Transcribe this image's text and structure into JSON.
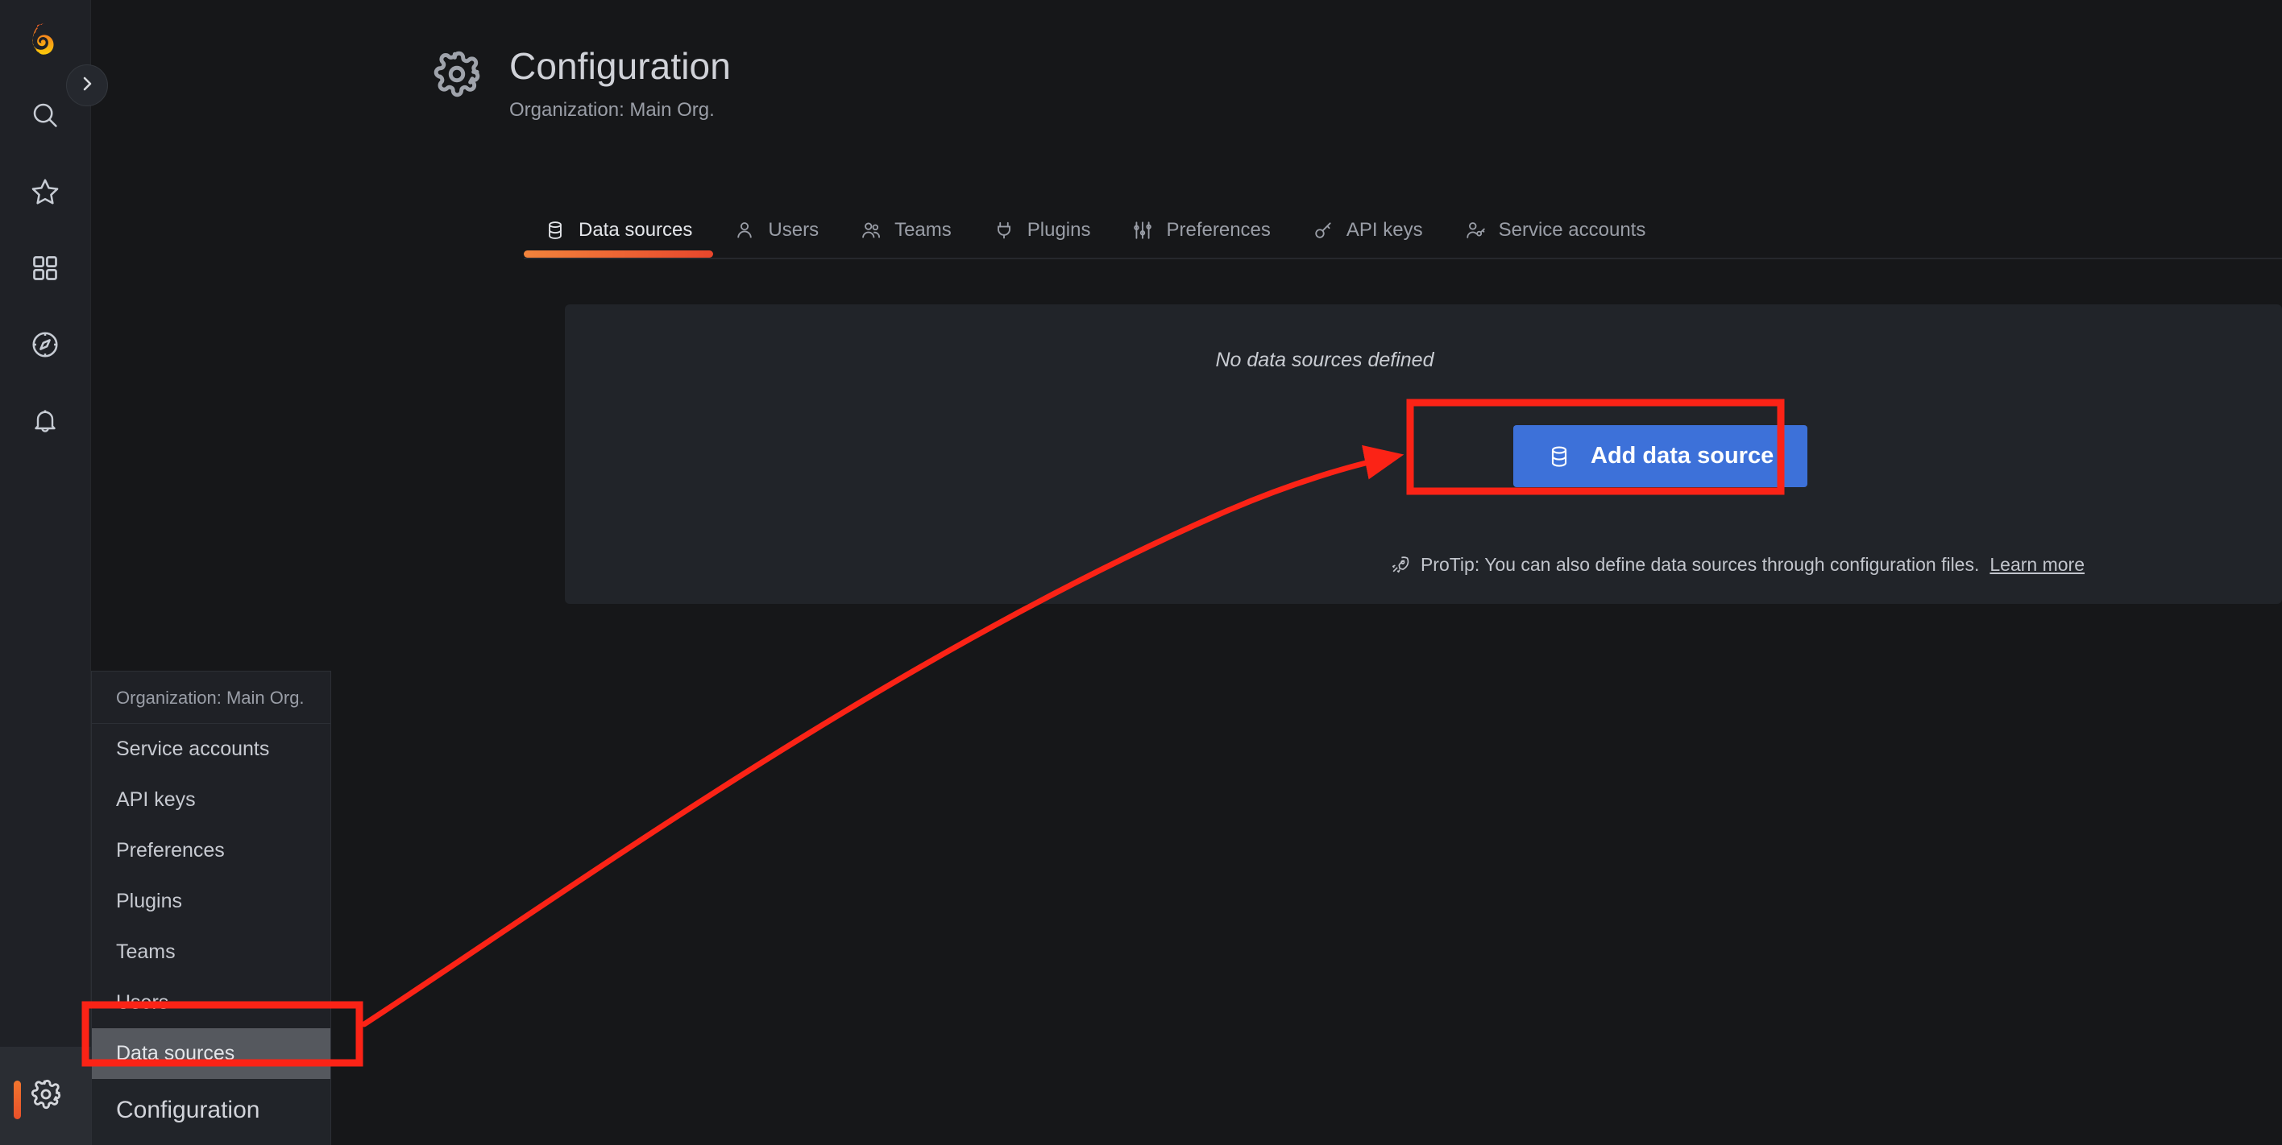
{
  "app": {
    "brand": "grafana-logo",
    "accent_orange": "#f2762e",
    "page_bg": "#161719",
    "panel_bg": "#212429",
    "primary_button_bg": "#3d71d9",
    "highlight_red": "#fb2316"
  },
  "sidebar": {
    "logo_name": "Grafana",
    "collapse_toggle": "chevron-right-icon",
    "items": [
      {
        "name": "search",
        "icon": "search-icon"
      },
      {
        "name": "starred",
        "icon": "star-icon"
      },
      {
        "name": "dashboards",
        "icon": "apps-grid-icon"
      },
      {
        "name": "explore",
        "icon": "compass-icon"
      },
      {
        "name": "alerting",
        "icon": "bell-icon"
      }
    ],
    "bottom_item": {
      "name": "configuration",
      "icon": "gear-icon",
      "active": true
    }
  },
  "header": {
    "icon": "gear-icon",
    "title": "Configuration",
    "subtitle": "Organization: Main Org."
  },
  "tabs": [
    {
      "label": "Data sources",
      "icon": "database-icon",
      "active": true
    },
    {
      "label": "Users",
      "icon": "user-icon",
      "active": false
    },
    {
      "label": "Teams",
      "icon": "users-icon",
      "active": false
    },
    {
      "label": "Plugins",
      "icon": "plug-icon",
      "active": false
    },
    {
      "label": "Preferences",
      "icon": "sliders-icon",
      "active": false
    },
    {
      "label": "API keys",
      "icon": "key-icon",
      "active": false
    },
    {
      "label": "Service accounts",
      "icon": "user-key-icon",
      "active": false
    }
  ],
  "main": {
    "empty_message": "No data sources defined",
    "add_button": {
      "label": "Add data source",
      "icon": "database-icon"
    },
    "protip": {
      "icon": "rocket-icon",
      "text": "ProTip: You can also define data sources through configuration files.",
      "link_label": "Learn more"
    }
  },
  "flyout": {
    "header": "Organization: Main Org.",
    "items": [
      {
        "label": "Service accounts",
        "selected": false
      },
      {
        "label": "API keys",
        "selected": false
      },
      {
        "label": "Preferences",
        "selected": false
      },
      {
        "label": "Plugins",
        "selected": false
      },
      {
        "label": "Teams",
        "selected": false
      },
      {
        "label": "Users",
        "selected": false
      },
      {
        "label": "Data sources",
        "selected": true
      }
    ],
    "footer": "Configuration"
  },
  "annotations": {
    "highlight_boxes": [
      {
        "name": "data-sources-menu-item-highlight"
      },
      {
        "name": "add-data-source-button-highlight"
      }
    ],
    "arrow": {
      "name": "guidance-arrow",
      "from": "data-sources-menu-item",
      "to": "add-data-source-button"
    }
  }
}
